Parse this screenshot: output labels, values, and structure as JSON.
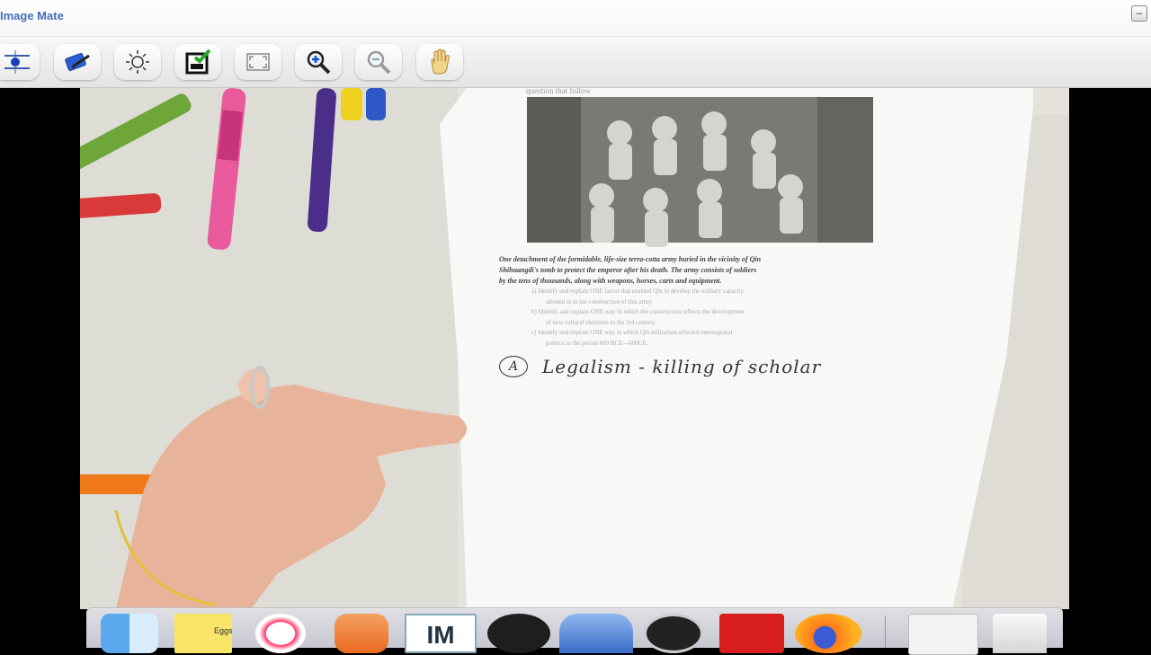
{
  "window": {
    "title": "Image Mate",
    "minimize_symbol": "–"
  },
  "toolbar": {
    "buttons": [
      {
        "name": "grid-tool",
        "icon": "grid-dot-icon"
      },
      {
        "name": "annotate-tool",
        "icon": "pen-tablet-icon"
      },
      {
        "name": "brightness-tool",
        "icon": "sun-icon"
      },
      {
        "name": "capture-tool",
        "icon": "capture-check-icon"
      },
      {
        "name": "fit-screen-tool",
        "icon": "fit-screen-icon"
      },
      {
        "name": "zoom-in-tool",
        "icon": "zoom-in-icon"
      },
      {
        "name": "zoom-out-tool",
        "icon": "zoom-out-icon"
      },
      {
        "name": "pan-tool",
        "icon": "hand-icon"
      }
    ]
  },
  "worksheet": {
    "header_fragment": "question that follow",
    "caption_line1": "One detachment of the formidable, life-size terra-cotta army buried in the vicinity of Qin",
    "caption_line2": "Shihuangdi's tomb to protect the emperor after his death.  The army consists of soldiers",
    "caption_line3": "by the tens of thousands, along with weapons, horses, carts and equipment.",
    "q_a_1": "a)   Identify and explain ONE factor that enabled Qin to develop the military capacity",
    "q_a_2": "allotted to in the construction of this army.",
    "q_b_1": "b)   Identify and explain ONE way in which the construction reflects the development",
    "q_b_2": "of new cultural identities in the 3rd century.",
    "q_c_1": "c)   Identify and explain ONE way in which Qin militarism affected interregional",
    "q_c_2": "politics in the period 600 BCE—600CE.",
    "handwriting_mark": "A",
    "handwriting_text": "Legalism - killing of scholar"
  },
  "dock": {
    "apps": [
      "Finder",
      "Stickies",
      "iTunes",
      "Presentation",
      "Image Mate",
      "OBS",
      "Launchpad",
      "Safari",
      "Acrobat",
      "Firefox",
      "Downloads",
      "Trash"
    ],
    "sticky_note_text": "Eggs"
  }
}
